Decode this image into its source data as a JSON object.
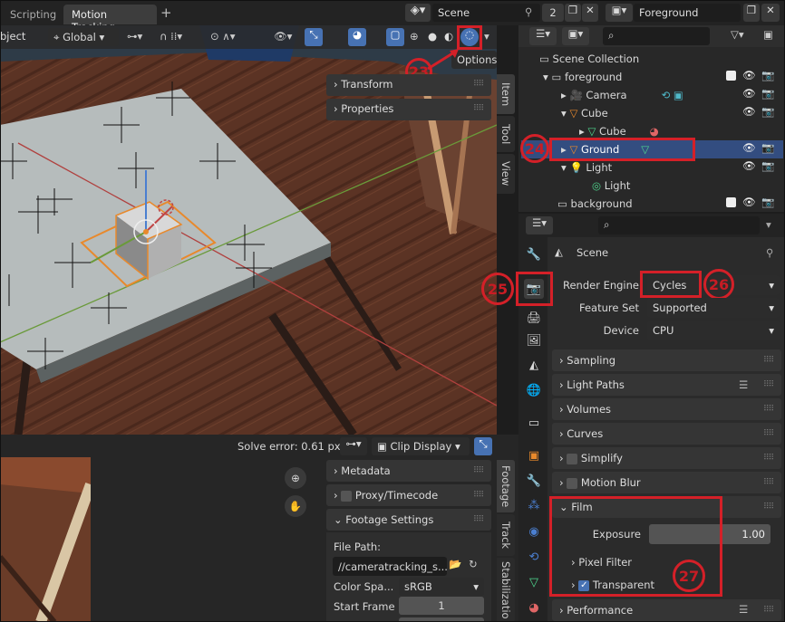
{
  "topbar": {
    "tabs": [
      "Scripting",
      "Motion Tracking"
    ],
    "add_tab": "+",
    "scene": "Scene",
    "users": "2",
    "view_layer": "Foreground"
  },
  "viewport_header": {
    "mode": "bject",
    "orientation": "Global",
    "options": "Options"
  },
  "npanel": {
    "sections": [
      "Transform",
      "Properties"
    ],
    "tabs": [
      "Item",
      "Tool",
      "View"
    ]
  },
  "outliner": {
    "search_placeholder": "",
    "root": "Scene Collection",
    "items": [
      {
        "label": "foreground"
      },
      {
        "label": "Camera"
      },
      {
        "label": "Cube"
      },
      {
        "label": "Cube"
      },
      {
        "label": "Ground"
      },
      {
        "label": "Light"
      },
      {
        "label": "Light"
      },
      {
        "label": "background"
      }
    ]
  },
  "properties": {
    "context": "Scene",
    "render_engine_label": "Render Engine",
    "render_engine": "Cycles",
    "feature_set_label": "Feature Set",
    "feature_set": "Supported",
    "device_label": "Device",
    "device": "CPU",
    "panels": [
      "Sampling",
      "Light Paths",
      "Volumes",
      "Curves",
      "Simplify",
      "Motion Blur"
    ],
    "film": {
      "title": "Film",
      "exposure_label": "Exposure",
      "exposure": "1.00",
      "pixel_filter": "Pixel Filter",
      "transparent": "Transparent"
    },
    "performance": "Performance"
  },
  "clip_editor": {
    "solve_error": "Solve error: 0.61 px",
    "display": "Clip Display",
    "sections": [
      "Metadata",
      "Proxy/Timecode",
      "Footage Settings"
    ],
    "file_path_label": "File Path:",
    "file_path": "//cameratracking_s...",
    "color_space_label": "Color Spa...",
    "color_space": "sRGB",
    "start_frame_label": "Start Frame",
    "start_frame": "1",
    "tabs": [
      "Footage",
      "Track",
      "Stabilizatio"
    ]
  },
  "annotations": [
    "23",
    "24",
    "25",
    "26",
    "27"
  ],
  "colors": {
    "highlight": "#334d80",
    "annotation": "#d42028",
    "accent": "#4772b3"
  }
}
